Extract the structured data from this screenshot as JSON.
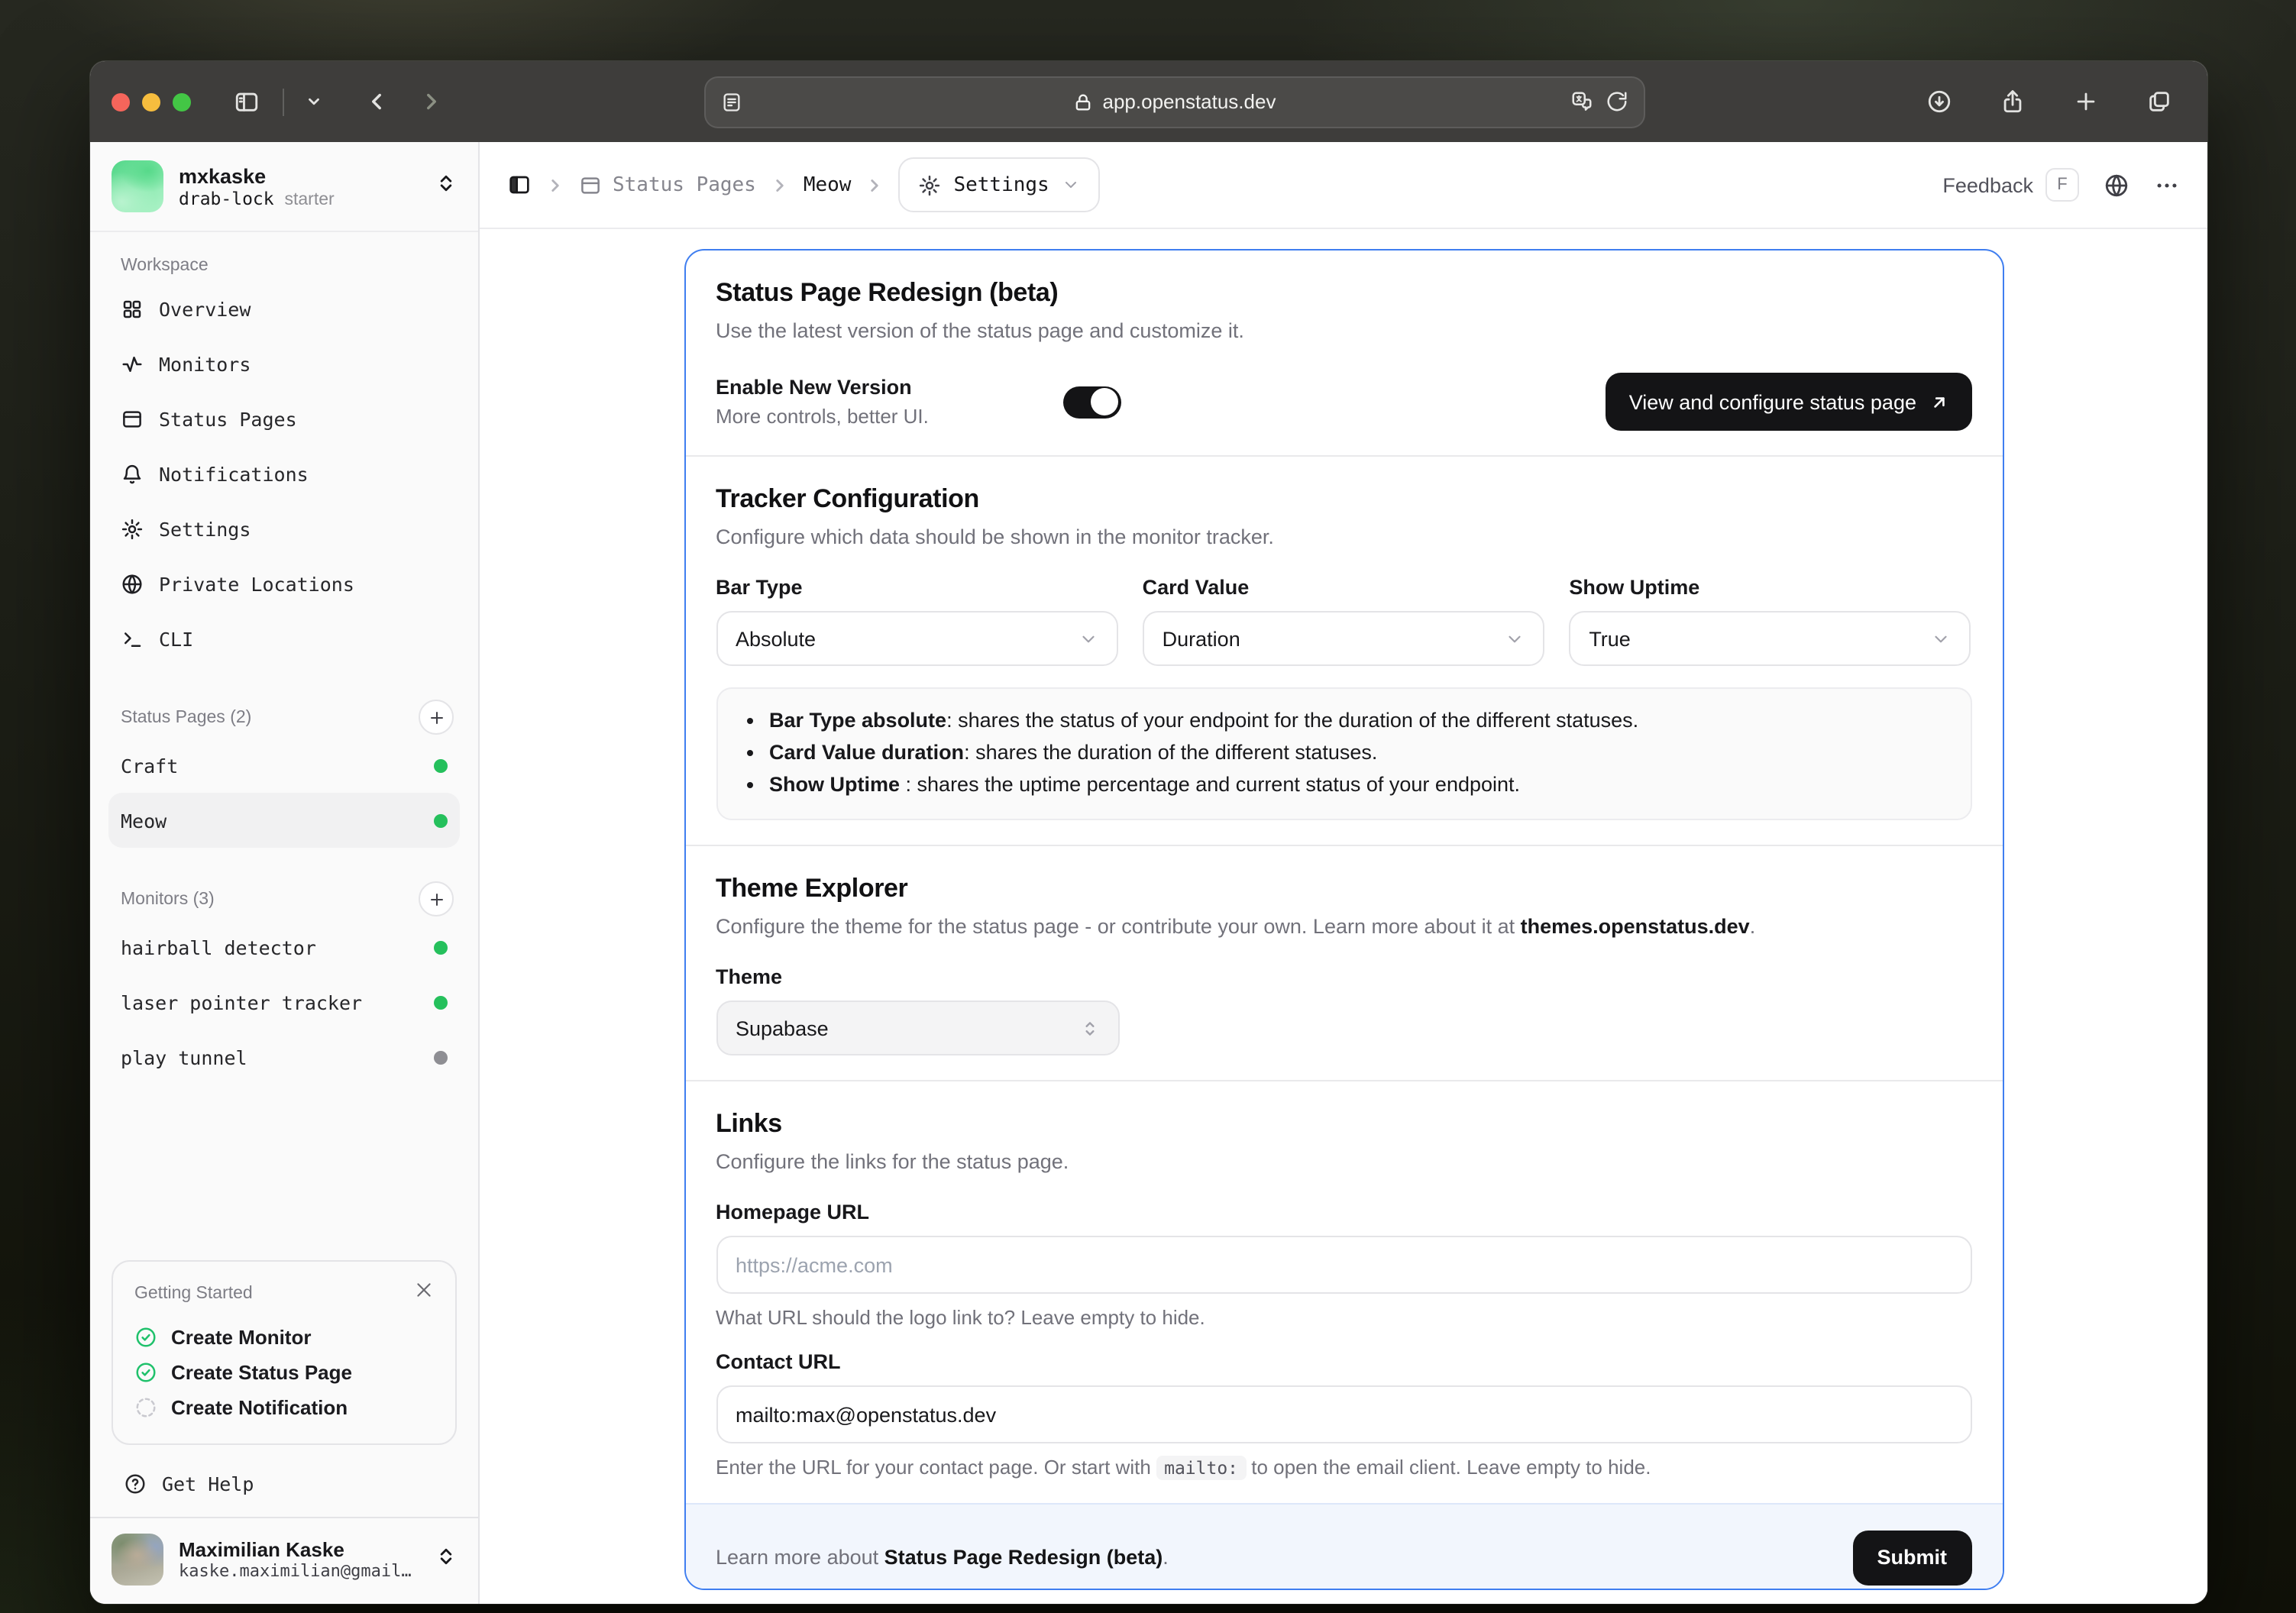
{
  "browser": {
    "url": "app.openstatus.dev"
  },
  "sidebar": {
    "workspace_name": "mxkaske",
    "workspace_slug": "drab-lock",
    "workspace_plan": "starter",
    "nav_label": "Workspace",
    "nav": [
      {
        "label": "Overview",
        "icon": "grid-icon"
      },
      {
        "label": "Monitors",
        "icon": "activity-icon"
      },
      {
        "label": "Status Pages",
        "icon": "status-page-icon"
      },
      {
        "label": "Notifications",
        "icon": "bell-icon"
      },
      {
        "label": "Settings",
        "icon": "gear-icon"
      },
      {
        "label": "Private Locations",
        "icon": "globe-icon"
      },
      {
        "label": "CLI",
        "icon": "terminal-icon"
      }
    ],
    "status_pages_label": "Status Pages (2)",
    "status_pages": [
      {
        "label": "Craft",
        "status": "operational"
      },
      {
        "label": "Meow",
        "status": "operational",
        "selected": true
      }
    ],
    "monitors_label": "Monitors (3)",
    "monitors": [
      {
        "label": "hairball detector",
        "status": "active"
      },
      {
        "label": "laser pointer tracker",
        "status": "active"
      },
      {
        "label": "play tunnel",
        "status": "inactive"
      }
    ],
    "getting_started": {
      "title": "Getting Started",
      "items": [
        {
          "label": "Create Monitor",
          "done": true
        },
        {
          "label": "Create Status Page",
          "done": true
        },
        {
          "label": "Create Notification",
          "done": false
        }
      ]
    },
    "get_help_label": "Get Help",
    "user": {
      "name": "Maximilian Kaske",
      "email": "kaske.maximilian@gmail…"
    }
  },
  "header": {
    "breadcrumb_parent": "Status Pages",
    "breadcrumb_current": "Meow",
    "settings_label": "Settings",
    "feedback_label": "Feedback",
    "feedback_key": "F"
  },
  "main": {
    "redesign": {
      "title": "Status Page Redesign (beta)",
      "description": "Use the latest version of the status page and customize it.",
      "toggle_label": "Enable New Version",
      "toggle_sublabel": "More controls, better UI.",
      "toggle_on": true,
      "cta_label": "View and configure status page"
    },
    "tracker": {
      "title": "Tracker Configuration",
      "description": "Configure which data should be shown in the monitor tracker.",
      "fields": [
        {
          "label": "Bar Type",
          "value": "Absolute"
        },
        {
          "label": "Card Value",
          "value": "Duration"
        },
        {
          "label": "Show Uptime",
          "value": "True"
        }
      ],
      "notes": [
        {
          "bold": "Bar Type absolute",
          "text": ": shares the status of your endpoint for the duration of the different statuses."
        },
        {
          "bold": "Card Value duration",
          "text": ": shares the duration of the different statuses."
        },
        {
          "bold": "Show Uptime ",
          "text": ": shares the uptime percentage and current status of your endpoint."
        }
      ]
    },
    "theme": {
      "title": "Theme Explorer",
      "description_prefix": "Configure the theme for the status page - or contribute your own. Learn more about it at ",
      "description_link": "themes.openstatus.dev",
      "description_suffix": ".",
      "field_label": "Theme",
      "value": "Supabase"
    },
    "links": {
      "title": "Links",
      "description": "Configure the links for the status page.",
      "homepage_label": "Homepage URL",
      "homepage_placeholder": "https://acme.com",
      "homepage_help": "What URL should the logo link to? Leave empty to hide.",
      "contact_label": "Contact URL",
      "contact_value": "mailto:max@openstatus.dev",
      "contact_help_prefix": "Enter the URL for your contact page. Or start with ",
      "contact_help_code": "mailto:",
      "contact_help_suffix": " to open the email client. Leave empty to hide."
    },
    "footer": {
      "text_prefix": "Learn more about ",
      "text_bold": "Status Page Redesign (beta)",
      "text_suffix": ".",
      "submit_label": "Submit"
    }
  },
  "colors": {
    "accent_blue": "#3f7ef0",
    "status_green": "#25c05c",
    "status_gray": "#8e8e93",
    "traffic_red": "#f5655b",
    "traffic_yellow": "#f6bd3e",
    "traffic_green": "#43c645"
  }
}
